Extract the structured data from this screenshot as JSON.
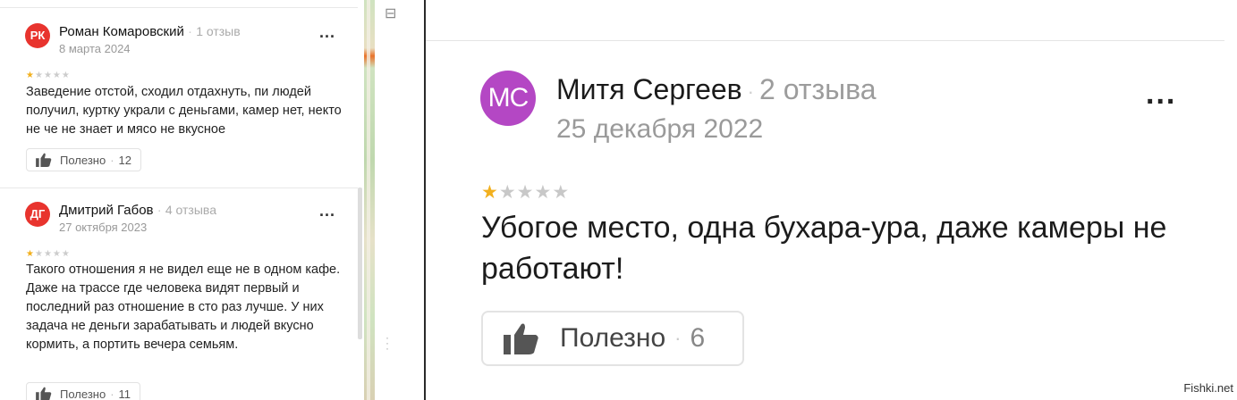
{
  "reviews_small": [
    {
      "initials": "РК",
      "avatar_color": "#e8342e",
      "name": "Роман Комаровский",
      "count": "1 отзыв",
      "date": "8 марта 2024",
      "menu": "...",
      "rating": 1,
      "text": "Заведение отстой, сходил отдахнуть, пи людей получил, куртку украли с деньгами, камер нет, некто не че не знает и мясо не вкусное",
      "useful_label": "Полезно",
      "useful_count": "12"
    },
    {
      "initials": "ДГ",
      "avatar_color": "#e8342e",
      "name": "Дмитрий Габов",
      "count": "4 отзыва",
      "date": "27 октября 2023",
      "menu": "...",
      "rating": 1,
      "text": "Такого отношения я не видел еще не в одном кафе. Даже на трассе где человека видят первый и последний раз отношение в сто раз лучше. У них задача не деньги зарабатывать и людей вкусно кормить, а портить вечера семьям.",
      "useful_label": "Полезно",
      "useful_count": "11"
    }
  ],
  "review_large": {
    "initials": "МС",
    "avatar_color": "#b447c4",
    "name": "Митя Сергеев",
    "count": "2 отзыва",
    "date": "25 декабря 2022",
    "menu": "...",
    "rating": 1,
    "text": "Убогое место, одна бухара-ура, даже камеры не работают!",
    "useful_label": "Полезно",
    "useful_count": "6"
  },
  "star_color_on": "#f2b01e",
  "star_color_off": "#c8c8c8",
  "icons": [
    "thumbs-up-icon",
    "more-dots-icon",
    "star-icon"
  ],
  "watermark": "Fishki.net"
}
